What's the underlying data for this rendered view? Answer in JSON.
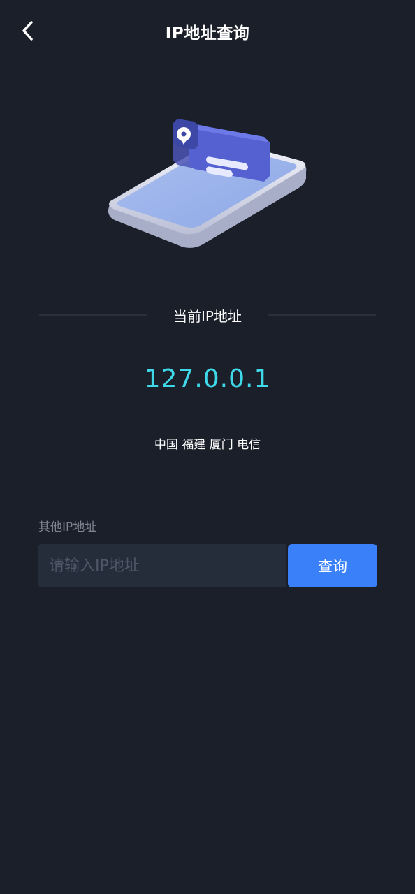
{
  "header": {
    "title": "IP地址查询",
    "back_icon": "chevron-left-icon"
  },
  "current_ip": {
    "section_label": "当前IP地址",
    "address": "127.0.0.1",
    "location": "中国 福建 厦门 电信",
    "address_color": "#3fd8e8"
  },
  "lookup": {
    "label": "其他IP地址",
    "placeholder": "请输入IP地址",
    "value": "",
    "button_label": "查询",
    "button_color": "#3a80f8"
  },
  "theme": {
    "background": "#1b1f29",
    "input_background": "#252c3a"
  }
}
